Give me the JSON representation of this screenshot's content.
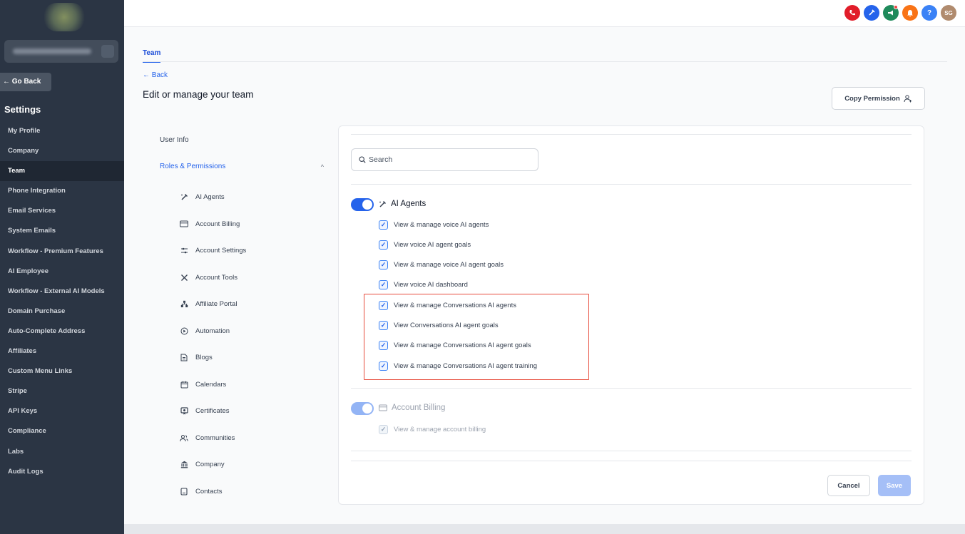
{
  "sidebar": {
    "go_back": "← Go Back",
    "title": "Settings",
    "items": [
      {
        "label": "My Profile"
      },
      {
        "label": "Company"
      },
      {
        "label": "Team",
        "active": true
      },
      {
        "label": "Phone Integration"
      },
      {
        "label": "Email Services"
      },
      {
        "label": "System Emails"
      },
      {
        "label": "Workflow - Premium Features"
      },
      {
        "label": "AI Employee"
      },
      {
        "label": "Workflow - External AI Models"
      },
      {
        "label": "Domain Purchase"
      },
      {
        "label": "Auto-Complete Address"
      },
      {
        "label": "Affiliates"
      },
      {
        "label": "Custom Menu Links"
      },
      {
        "label": "Stripe"
      },
      {
        "label": "API Keys"
      },
      {
        "label": "Compliance"
      },
      {
        "label": "Labs"
      },
      {
        "label": "Audit Logs"
      }
    ]
  },
  "topbar": {
    "icons": [
      {
        "name": "phone-icon",
        "color": "#e11d2a"
      },
      {
        "name": "ai-agent-icon",
        "color": "#2563eb"
      },
      {
        "name": "megaphone-icon",
        "color": "#1f8a5b"
      },
      {
        "name": "bell-icon",
        "color": "#f97316"
      },
      {
        "name": "help-icon",
        "color": "#3b82f6"
      }
    ],
    "avatar_initials": "SG",
    "avatar_color": "#b08b6e"
  },
  "tabs": {
    "active": "Team"
  },
  "page": {
    "back": "← Back",
    "title": "Edit or manage your team",
    "copy_permission": "Copy Permission"
  },
  "perm_menu": {
    "user_info": "User Info",
    "roles": "Roles & Permissions",
    "items": [
      {
        "label": "AI Agents",
        "icon": "ai-agent-icon"
      },
      {
        "label": "Account Billing",
        "icon": "billing-icon"
      },
      {
        "label": "Account Settings",
        "icon": "settings-sliders-icon"
      },
      {
        "label": "Account Tools",
        "icon": "tools-icon"
      },
      {
        "label": "Affiliate Portal",
        "icon": "affiliate-icon"
      },
      {
        "label": "Automation",
        "icon": "automation-icon"
      },
      {
        "label": "Blogs",
        "icon": "blog-icon"
      },
      {
        "label": "Calendars",
        "icon": "calendar-icon"
      },
      {
        "label": "Certificates",
        "icon": "certificate-icon"
      },
      {
        "label": "Communities",
        "icon": "communities-icon"
      },
      {
        "label": "Company",
        "icon": "bank-icon"
      },
      {
        "label": "Contacts",
        "icon": "contacts-icon"
      }
    ]
  },
  "search": {
    "placeholder": "Search"
  },
  "groups": {
    "ai_agents": {
      "label": "AI Agents",
      "enabled": true,
      "permissions": [
        "View & manage voice AI agents",
        "View voice AI agent goals",
        "View & manage voice AI agent goals",
        "View voice AI dashboard",
        "View & manage Conversations AI agents",
        "View Conversations AI agent goals",
        "View & manage Conversations AI agent goals",
        "View & manage Conversations AI agent training"
      ]
    },
    "account_billing": {
      "label": "Account Billing",
      "enabled": true,
      "disabled_state": true,
      "permissions": [
        "View & manage account billing"
      ]
    }
  },
  "actions": {
    "cancel": "Cancel",
    "save": "Save"
  }
}
